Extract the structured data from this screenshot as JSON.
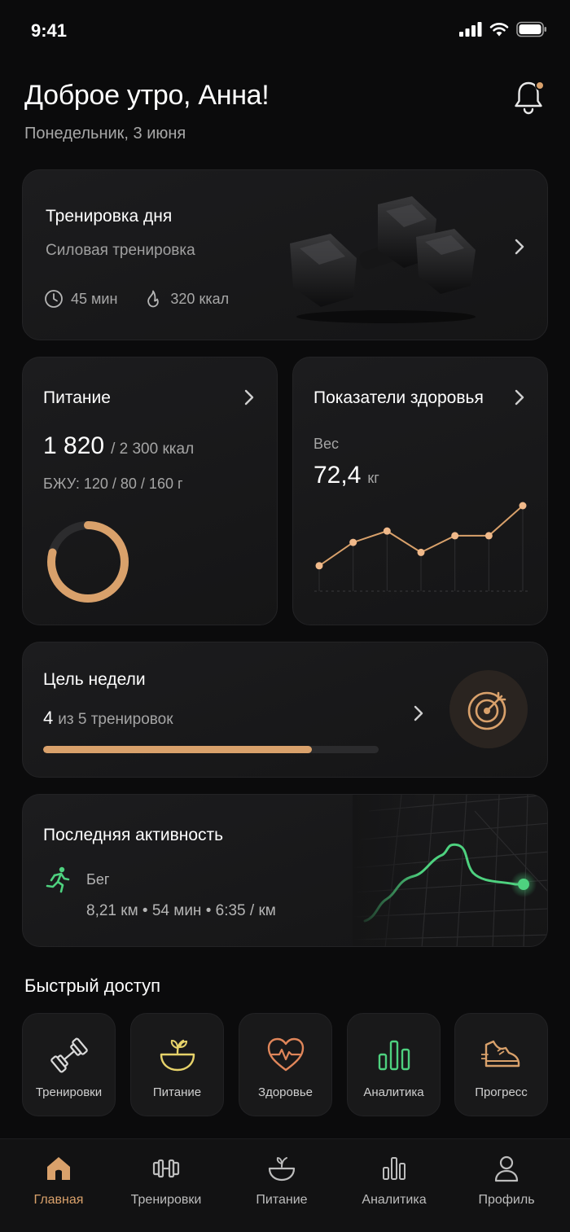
{
  "status_bar": {
    "time": "9:41"
  },
  "header": {
    "greeting": "Доброе утро, Анна!",
    "date": "Понедельник, 3 июня"
  },
  "workout_card": {
    "title": "Тренировка дня",
    "subtitle": "Силовая тренировка",
    "duration": "45 мин",
    "calories": "320 ккал"
  },
  "nutrition_card": {
    "title": "Питание",
    "consumed": "1 820",
    "target": "/ 2 300 ккал",
    "macros": "БЖУ: 120 / 80 / 160 г",
    "ring_fraction": 0.79,
    "accent": "#d9a16b"
  },
  "health_card": {
    "title": "Показатели здоровья",
    "metric_label": "Вес",
    "weight_value": "72,4",
    "weight_unit": "кг",
    "trend_points": [
      0.1,
      0.45,
      0.62,
      0.3,
      0.55,
      0.55,
      1.0
    ]
  },
  "goal_card": {
    "title": "Цель недели",
    "count": "4",
    "of_text": "из 5 тренировок",
    "progress": 0.8
  },
  "activity_card": {
    "title": "Последняя активность",
    "type": "Бег",
    "stats": "8,21 км • 54 мин • 6:35 / км",
    "route_color": "#4ed17f"
  },
  "quick_access": {
    "title": "Быстрый доступ",
    "items": [
      {
        "label": "Тренировки",
        "icon": "dumbbell-icon"
      },
      {
        "label": "Питание",
        "icon": "bowl-icon"
      },
      {
        "label": "Здоровье",
        "icon": "heart-pulse-icon"
      },
      {
        "label": "Аналитика",
        "icon": "bar-chart-icon"
      },
      {
        "label": "Прогресс",
        "icon": "sneaker-icon"
      }
    ]
  },
  "bottom_nav": {
    "items": [
      {
        "label": "Главная",
        "icon": "home-icon",
        "active": true
      },
      {
        "label": "Тренировки",
        "icon": "dumbbell-icon",
        "active": false
      },
      {
        "label": "Питание",
        "icon": "bowl-icon",
        "active": false
      },
      {
        "label": "Аналитика",
        "icon": "bar-chart-icon",
        "active": false
      },
      {
        "label": "Профиль",
        "icon": "user-icon",
        "active": false
      }
    ]
  }
}
